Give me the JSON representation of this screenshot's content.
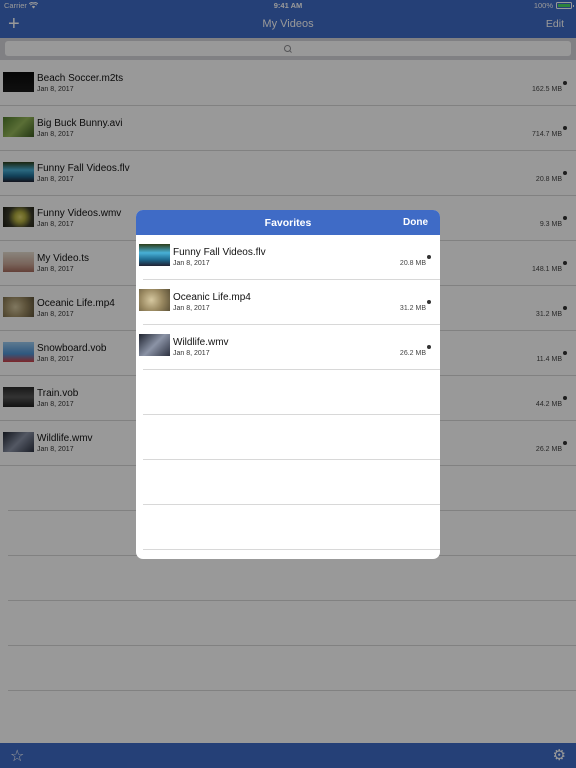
{
  "status_bar": {
    "carrier": "Carrier",
    "time": "9:41 AM",
    "battery": "100%"
  },
  "nav": {
    "add_label": "+",
    "title": "My Videos",
    "edit_label": "Edit"
  },
  "videos": [
    {
      "name": "Beach Soccer.m2ts",
      "date": "Jan 8, 2017",
      "size": "162.5 MB"
    },
    {
      "name": "Big Buck Bunny.avi",
      "date": "Jan 8, 2017",
      "size": "714.7 MB"
    },
    {
      "name": "Funny Fall Videos.flv",
      "date": "Jan 8, 2017",
      "size": "20.8 MB"
    },
    {
      "name": "Funny Videos.wmv",
      "date": "Jan 8, 2017",
      "size": "9.3 MB"
    },
    {
      "name": "My Video.ts",
      "date": "Jan 8, 2017",
      "size": "148.1 MB"
    },
    {
      "name": "Oceanic Life.mp4",
      "date": "Jan 8, 2017",
      "size": "31.2 MB"
    },
    {
      "name": "Snowboard.vob",
      "date": "Jan 8, 2017",
      "size": "11.4 MB"
    },
    {
      "name": "Train.vob",
      "date": "Jan 8, 2017",
      "size": "44.2 MB"
    },
    {
      "name": "Wildlife.wmv",
      "date": "Jan 8, 2017",
      "size": "26.2 MB"
    }
  ],
  "favorites": {
    "title": "Favorites",
    "done_label": "Done",
    "items": [
      {
        "name": "Funny Fall Videos.flv",
        "date": "Jan 8, 2017",
        "size": "20.8 MB"
      },
      {
        "name": "Oceanic Life.mp4",
        "date": "Jan 8, 2017",
        "size": "31.2 MB"
      },
      {
        "name": "Wildlife.wmv",
        "date": "Jan 8, 2017",
        "size": "26.2 MB"
      }
    ]
  },
  "toolbar": {
    "star_glyph": "☆",
    "gear_glyph": "⚙"
  },
  "colors": {
    "accent": "#3f6bc6",
    "battery": "#4cd964"
  }
}
